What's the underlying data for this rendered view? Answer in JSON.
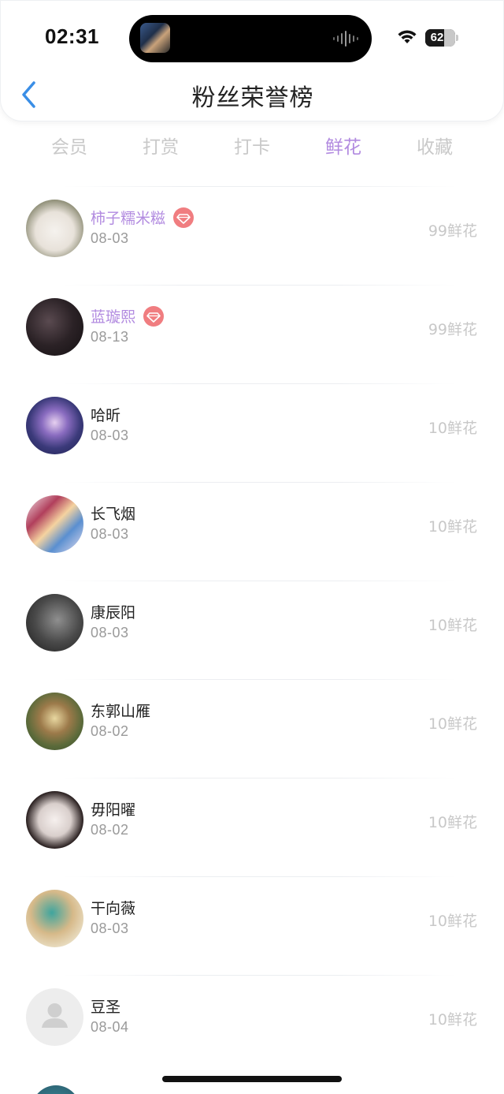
{
  "status_bar": {
    "time": "02:31",
    "battery": "62",
    "battery_level": 0.62
  },
  "header": {
    "title": "粉丝荣誉榜"
  },
  "tabs": [
    {
      "label": "会员",
      "active": false
    },
    {
      "label": "打赏",
      "active": false
    },
    {
      "label": "打卡",
      "active": false
    },
    {
      "label": "鲜花",
      "active": true
    },
    {
      "label": "收藏",
      "active": false
    }
  ],
  "colors": {
    "accent": "#b28be0",
    "vip_badge": "#f07d80",
    "back_icon": "#3a8ee6"
  },
  "fans": [
    {
      "name": "柿子糯米糍",
      "date": "08-03",
      "amount": "99鲜花",
      "vip": true
    },
    {
      "name": "蓝璇熙",
      "date": "08-13",
      "amount": "99鲜花",
      "vip": true
    },
    {
      "name": "哈昕",
      "date": "08-03",
      "amount": "10鲜花",
      "vip": false
    },
    {
      "name": "长飞烟",
      "date": "08-03",
      "amount": "10鲜花",
      "vip": false
    },
    {
      "name": "康辰阳",
      "date": "08-03",
      "amount": "10鲜花",
      "vip": false
    },
    {
      "name": "东郭山雁",
      "date": "08-02",
      "amount": "10鲜花",
      "vip": false
    },
    {
      "name": "毋阳曜",
      "date": "08-02",
      "amount": "10鲜花",
      "vip": false
    },
    {
      "name": "干向薇",
      "date": "08-03",
      "amount": "10鲜花",
      "vip": false
    },
    {
      "name": "豆圣",
      "date": "08-04",
      "amount": "10鲜花",
      "vip": false
    }
  ]
}
